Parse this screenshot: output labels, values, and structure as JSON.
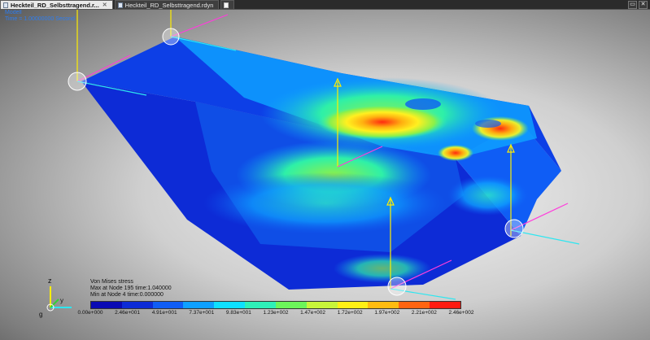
{
  "tabs": [
    {
      "label": "Heckteil_RD_Selbsttragend.r...",
      "active": true
    },
    {
      "label": "Heckteil_RD_Selbsttragend.rdyn",
      "active": false
    }
  ],
  "viewport": {
    "mode_label": "Modell",
    "time_label": "Time = 1.00000000 Second"
  },
  "legend": {
    "title": "Von Mises stress",
    "max_text": "Max at Node 195 time:1.040000",
    "min_text": "Min at Node 4 time:0.000000",
    "colors": [
      "#0a0ab4",
      "#0d2bd6",
      "#0f5df5",
      "#0ea0ff",
      "#0ee0ff",
      "#2ef0b8",
      "#6cf55a",
      "#c8f53a",
      "#fff015",
      "#ffbb10",
      "#ff6410",
      "#ff1a10"
    ],
    "tick_labels": [
      "0.00e+000",
      "2.46e+001",
      "4.91e+001",
      "7.37e+001",
      "9.83e+001",
      "1.23e+002",
      "1.47e+002",
      "1.72e+002",
      "1.97e+002",
      "2.21e+002",
      "2.46e+002"
    ]
  },
  "triad": {
    "z": "z",
    "y": "y",
    "g": "g"
  }
}
